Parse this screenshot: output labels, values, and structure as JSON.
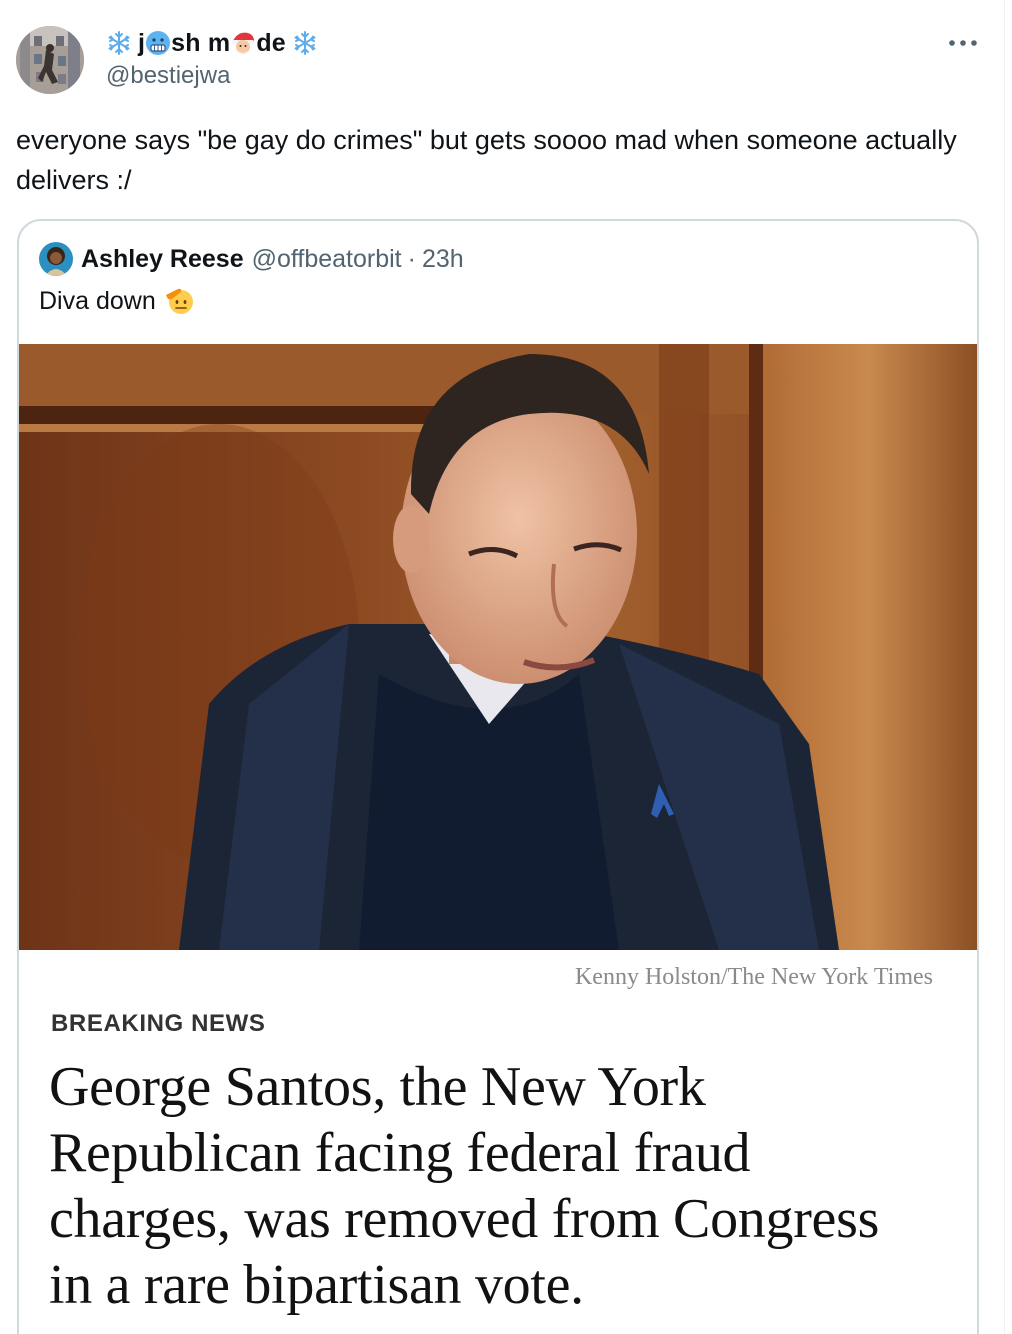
{
  "tweet": {
    "author": {
      "name_parts": [
        "j",
        "sh m",
        "de"
      ],
      "name_emojis": [
        "snowflake-emoji",
        "cold-face-emoji",
        "santa-emoji",
        "snowflake-emoji"
      ],
      "handle": "@bestiejwa"
    },
    "text": "everyone says \"be gay do crimes\" but gets soooo mad when someone actually delivers :/",
    "more_icon": "more-horizontal-icon"
  },
  "quote": {
    "author_name": "Ashley Reese",
    "author_handle": "@offbeatorbit",
    "separator": "·",
    "time": "23h",
    "text": "Diva down",
    "text_emoji": "saluting-face-emoji",
    "image": {
      "photo_credit": "Kenny Holston/The New York Times",
      "kicker": "BREAKING NEWS",
      "headline": "George Santos, the New York Republican facing federal fraud charges, was removed from Congress in a rare bipartisan vote."
    }
  },
  "colors": {
    "text_primary": "#0f1419",
    "text_secondary": "#536471",
    "card_border": "#cfd9de"
  }
}
